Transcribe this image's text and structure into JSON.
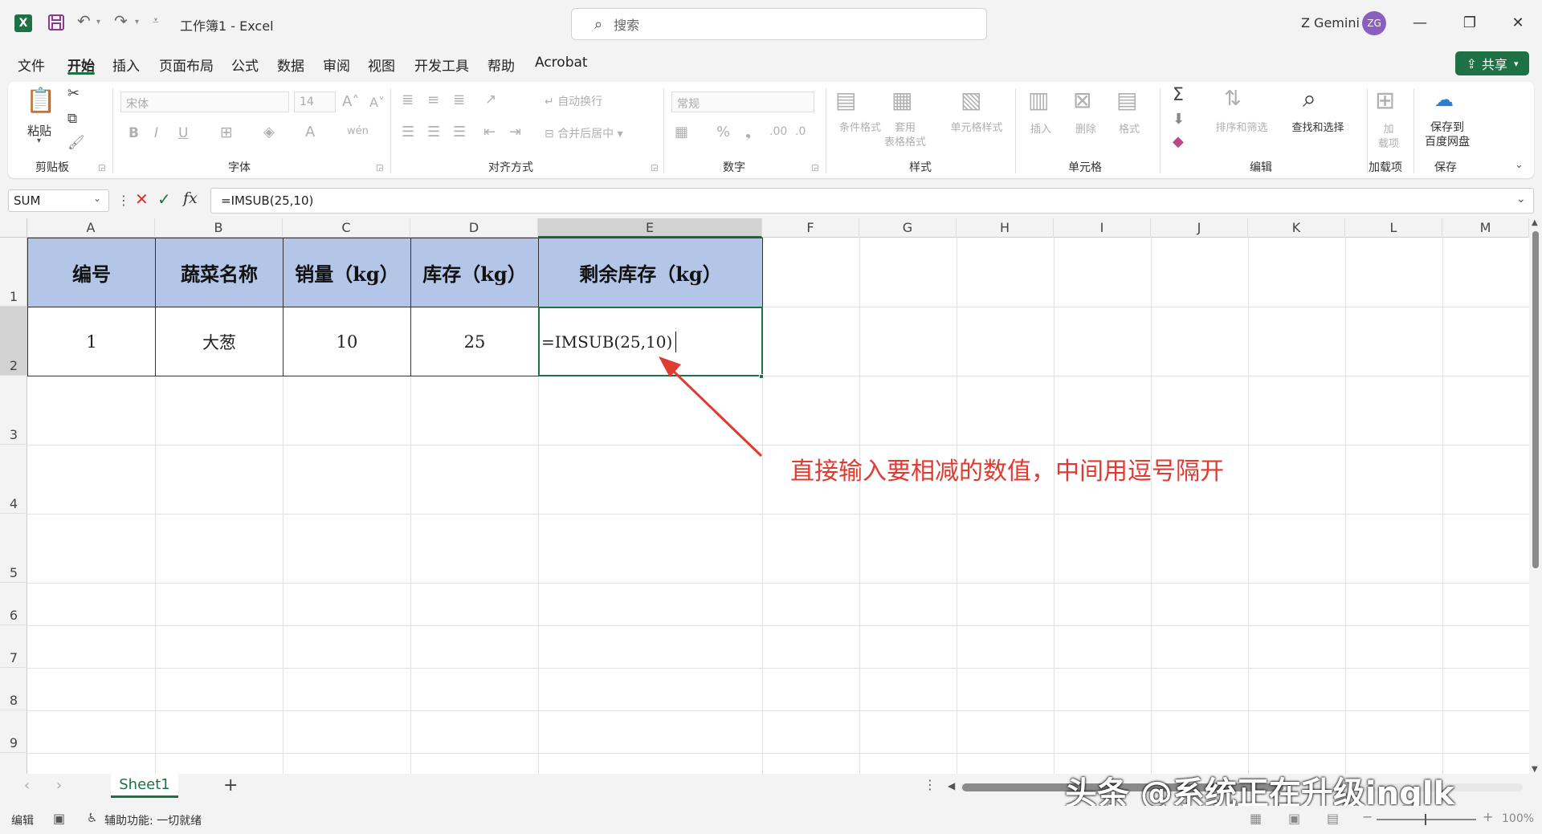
{
  "app": {
    "logo": "X",
    "title": "工作簿1 - Excel"
  },
  "search": {
    "placeholder": "搜索"
  },
  "user": {
    "name": "Z Gemini",
    "initials": "ZG"
  },
  "menu": {
    "tabs": [
      "文件",
      "开始",
      "插入",
      "页面布局",
      "公式",
      "数据",
      "审阅",
      "视图",
      "开发工具",
      "帮助",
      "Acrobat"
    ],
    "active": "开始",
    "share": "共享"
  },
  "ribbon": {
    "clipboard": {
      "label": "剪贴板",
      "paste": "粘贴"
    },
    "font": {
      "label": "字体",
      "name": "宋体",
      "size": "14"
    },
    "alignment": {
      "label": "对齐方式",
      "wrap": "自动换行",
      "merge": "合并后居中"
    },
    "number": {
      "label": "数字",
      "format": "常规"
    },
    "styles": {
      "label": "样式",
      "conditional": "条件格式",
      "table_1": "套用",
      "table_2": "表格格式",
      "cell_styles": "单元格样式"
    },
    "cells": {
      "label": "单元格",
      "insert": "插入",
      "delete": "删除",
      "format": "格式"
    },
    "editing": {
      "label": "编辑",
      "sort": "排序和筛选",
      "find": "查找和选择"
    },
    "addins": {
      "label": "加载项",
      "addin_1": "加",
      "addin_2": "载项"
    },
    "save": {
      "label": "保存",
      "baidu_1": "保存到",
      "baidu_2": "百度网盘"
    }
  },
  "formula_bar": {
    "namebox": "SUM",
    "formula": "=IMSUB(25,10)"
  },
  "columns": [
    "A",
    "B",
    "C",
    "D",
    "E",
    "F",
    "G",
    "H",
    "I",
    "J",
    "K",
    "L",
    "M"
  ],
  "rows": [
    "1",
    "2",
    "3",
    "4",
    "5",
    "6",
    "7",
    "8",
    "9"
  ],
  "table": {
    "headers": [
      "编号",
      "蔬菜名称",
      "销量（kg）",
      "库存（kg）",
      "剩余库存（kg）"
    ],
    "row": [
      "1",
      "大葱",
      "10",
      "25",
      "=IMSUB(25,10)"
    ]
  },
  "annotation": "直接输入要相减的数值，中间用逗号隔开",
  "sheets": {
    "active": "Sheet1"
  },
  "status": {
    "mode": "编辑",
    "accessibility": "辅助功能: 一切就绪",
    "zoom": "100%"
  },
  "watermark": "头条 @系统正在升级inglk",
  "colors": {
    "accent": "#1e7145",
    "header_fill": "#b4c6e7",
    "annotation": "#e03a31"
  }
}
